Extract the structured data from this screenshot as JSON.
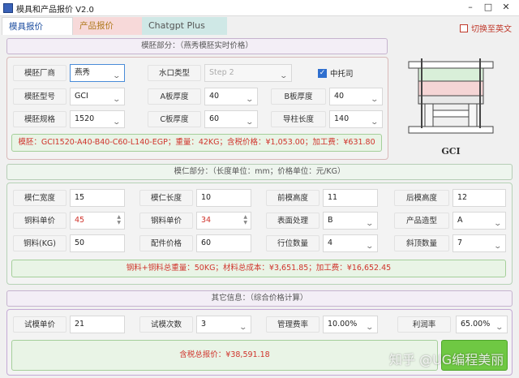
{
  "window": {
    "title": "模具和产品报价 V2.0"
  },
  "tabs": [
    "模具报价",
    "产品报价",
    "Chatgpt Plus"
  ],
  "language_toggle": {
    "label": "切换至英文",
    "checked": false
  },
  "mold_base": {
    "header": "模胚部分：（燕秀模胚实时价格）",
    "fields": {
      "vendor": {
        "label": "模胚厂商",
        "value": "燕秀"
      },
      "gate_type": {
        "label": "水口类型",
        "value": "Step 2"
      },
      "mid_plate": {
        "label": "中托司",
        "checked": true
      },
      "model": {
        "label": "模胚型号",
        "value": "GCI"
      },
      "a_plate": {
        "label": "A板厚度",
        "value": "40"
      },
      "b_plate": {
        "label": "B板厚度",
        "value": "40"
      },
      "spec": {
        "label": "模胚规格",
        "value": "1520"
      },
      "c_plate": {
        "label": "C板厚度",
        "value": "60"
      },
      "guide": {
        "label": "导柱长度",
        "value": "140"
      }
    },
    "result": "模胚：GCI1520-A40-B40-C60-L140-EGP；重量：42KG；含税价格：¥1,053.00；加工费：¥631.80",
    "image_caption": "GCI"
  },
  "core": {
    "header": "模仁部分：（长度单位：mm；价格单位：元/KG）",
    "fields": {
      "core_width": {
        "label": "模仁宽度",
        "value": "15"
      },
      "core_length": {
        "label": "模仁长度",
        "value": "10"
      },
      "front_height": {
        "label": "前模高度",
        "value": "11"
      },
      "back_height": {
        "label": "后模高度",
        "value": "12"
      },
      "copper_price": {
        "label": "铜料单价",
        "value": "45"
      },
      "steel_price": {
        "label": "钢料单价",
        "value": "34"
      },
      "surface": {
        "label": "表面处理",
        "value": "B"
      },
      "shape": {
        "label": "产品造型",
        "value": "A"
      },
      "copper_kg": {
        "label": "铜料(KG)",
        "value": "50"
      },
      "parts_price": {
        "label": "配件价格",
        "value": "60"
      },
      "slide_count": {
        "label": "行位数量",
        "value": "4"
      },
      "lifter_count": {
        "label": "斜顶数量",
        "value": "7"
      }
    },
    "result": "钢料+铜料总重量：50KG；材料总成本：¥3,651.85；加工费：¥16,652.45"
  },
  "other": {
    "header": "其它信息：（综合价格计算）",
    "fields": {
      "trial_price": {
        "label": "试模单价",
        "value": "21"
      },
      "trial_count": {
        "label": "试模次数",
        "value": "3"
      },
      "mgmt_rate": {
        "label": "管理费率",
        "value": "10.00%"
      },
      "profit_rate": {
        "label": "利润率",
        "value": "65.00%"
      }
    },
    "total": "含税总报价：¥38,591.18"
  },
  "watermark": "知乎 @UG编程美丽",
  "colors": {
    "accent_red": "#d0342c",
    "result_bg": "#e9f4e6",
    "tab_active_text": "#1f4fa0"
  }
}
